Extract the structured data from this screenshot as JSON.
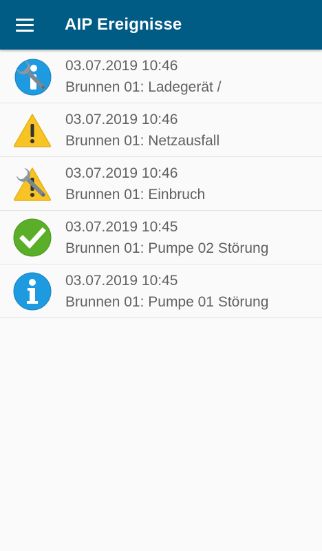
{
  "app_bar": {
    "title": "AIP Ereignisse",
    "menu_icon": "hamburger-menu-icon",
    "background": "#005b85"
  },
  "events": [
    {
      "icon": "info-wrench-icon",
      "date": "03.07.2019 10:46",
      "text": "Brunnen 01: Ladegerät /"
    },
    {
      "icon": "warning-icon",
      "date": "03.07.2019 10:46",
      "text": "Brunnen 01: Netzausfall"
    },
    {
      "icon": "warning-wrench-icon",
      "date": "03.07.2019 10:46",
      "text": "Brunnen 01: Einbruch"
    },
    {
      "icon": "check-icon",
      "date": "03.07.2019 10:45",
      "text": "Brunnen 01: Pumpe 02 Störung"
    },
    {
      "icon": "info-icon",
      "date": "03.07.2019 10:45",
      "text": "Brunnen 01: Pumpe 01 Störung"
    }
  ],
  "colors": {
    "info_blue": "#1e9be0",
    "warning_yellow": "#f7c325",
    "ok_green": "#5aae28",
    "wrench_grey": "#7b8791",
    "text": "#616161"
  }
}
